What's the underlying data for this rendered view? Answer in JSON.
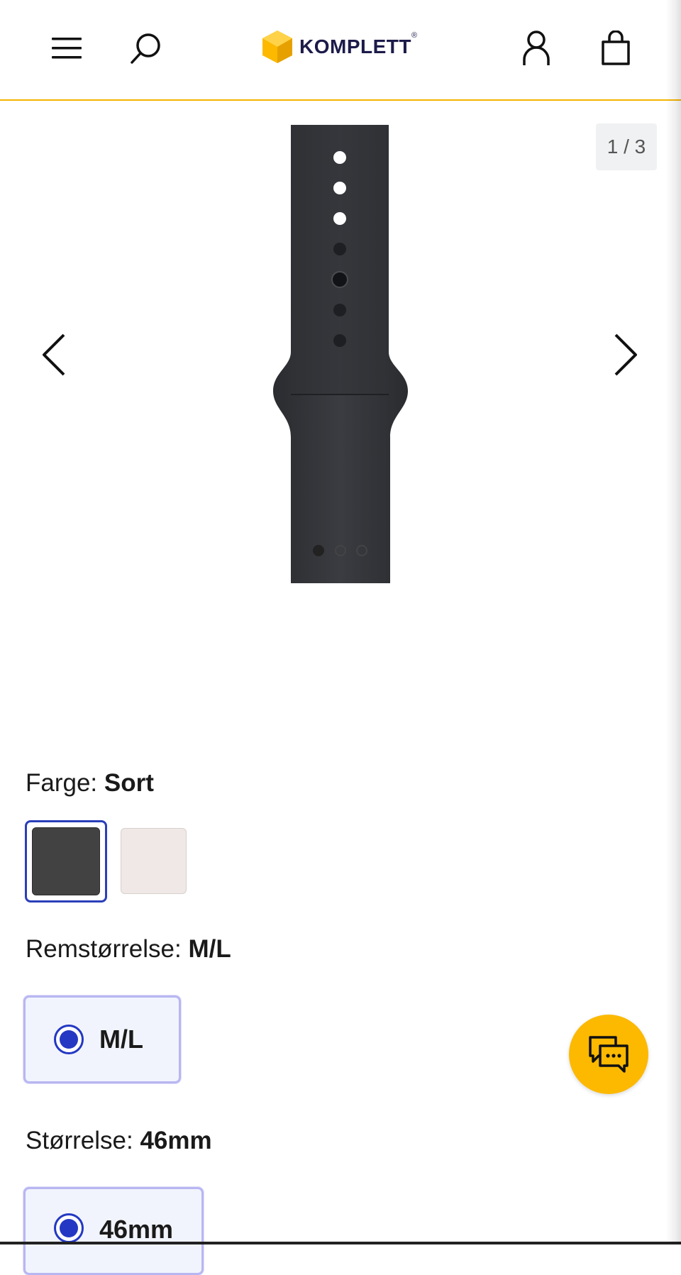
{
  "header": {
    "menu_icon": "hamburger-menu-icon",
    "search_icon": "search-icon",
    "logo_text": "KOMPLETT",
    "logo_reg": "®",
    "account_icon": "user-icon",
    "cart_icon": "shopping-bag-icon",
    "accent_color": "#f5b400"
  },
  "gallery": {
    "counter": "1 / 3",
    "prev_icon": "chevron-left-icon",
    "next_icon": "chevron-right-icon",
    "active_dot": 1,
    "total_dots": 3
  },
  "color": {
    "label": "Farge:",
    "value": "Sort",
    "swatches": [
      {
        "name": "Sort",
        "hex": "#424242",
        "selected": true
      },
      {
        "name": "Light",
        "hex": "#efe8e6",
        "selected": false
      }
    ]
  },
  "band_size": {
    "label": "Remstørrelse:",
    "value": "M/L",
    "options": [
      {
        "label": "M/L",
        "selected": true
      }
    ]
  },
  "size": {
    "label": "Størrelse:",
    "value": "46mm",
    "options": [
      {
        "label": "46mm",
        "selected": true
      }
    ]
  },
  "chat": {
    "icon": "chat-bubbles-icon",
    "color": "#fcb900"
  }
}
